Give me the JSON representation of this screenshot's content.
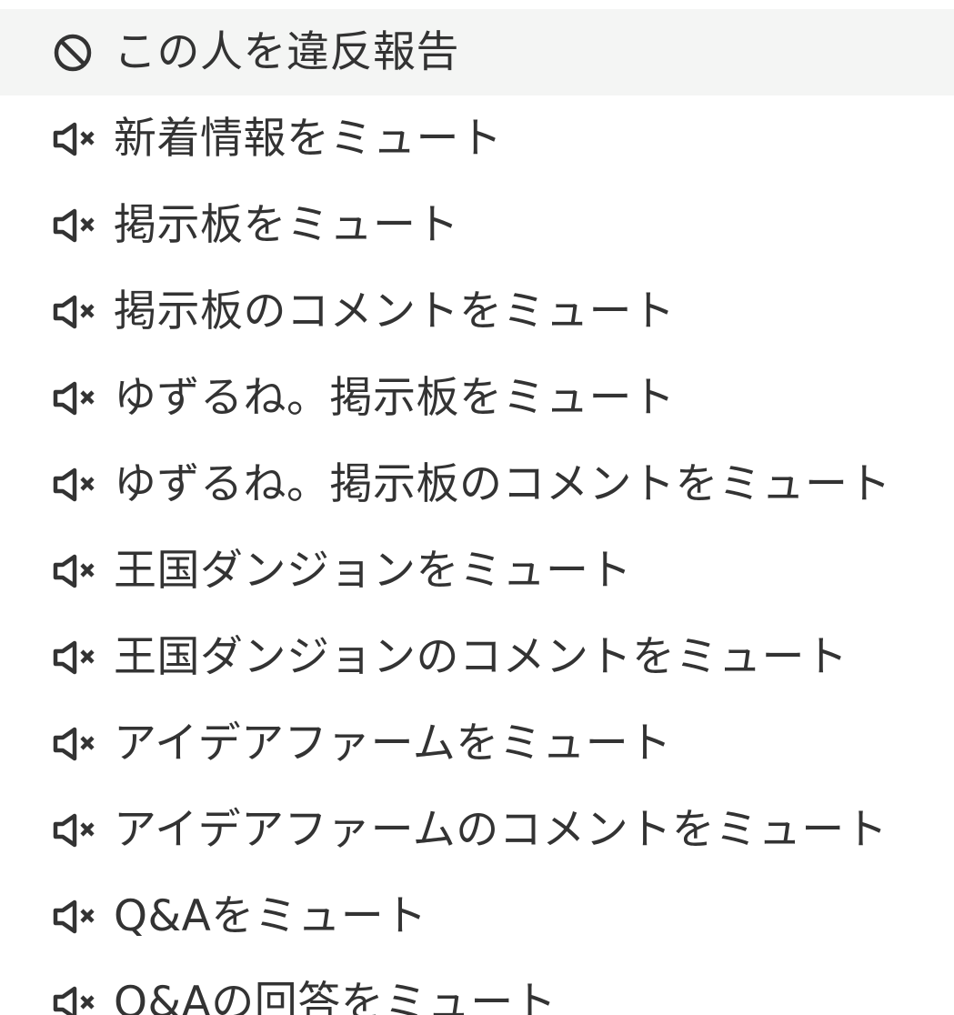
{
  "colors": {
    "text": "#333333",
    "highlight_background": "#f4f5f4",
    "background": "#ffffff"
  },
  "menu": {
    "report": {
      "icon": "ban-icon",
      "label": "この人を違反報告"
    },
    "mute_items": [
      {
        "icon": "mute-icon",
        "label": "新着情報をミュート"
      },
      {
        "icon": "mute-icon",
        "label": "掲示板をミュート"
      },
      {
        "icon": "mute-icon",
        "label": "掲示板のコメントをミュート"
      },
      {
        "icon": "mute-icon",
        "label": "ゆずるね。掲示板をミュート"
      },
      {
        "icon": "mute-icon",
        "label": "ゆずるね。掲示板のコメントをミュート"
      },
      {
        "icon": "mute-icon",
        "label": "王国ダンジョンをミュート"
      },
      {
        "icon": "mute-icon",
        "label": "王国ダンジョンのコメントをミュート"
      },
      {
        "icon": "mute-icon",
        "label": "アイデアファームをミュート"
      },
      {
        "icon": "mute-icon",
        "label": "アイデアファームのコメントをミュート"
      },
      {
        "icon": "mute-icon",
        "label": "Q&Aをミュート"
      },
      {
        "icon": "mute-icon",
        "label": "Q&Aの回答をミュート"
      }
    ]
  }
}
